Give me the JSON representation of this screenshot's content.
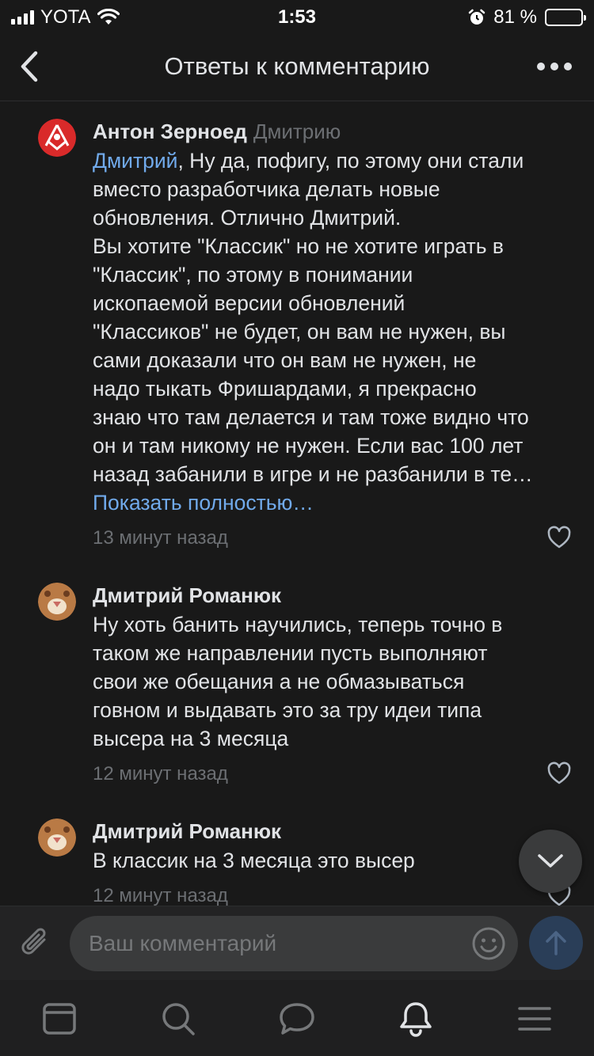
{
  "status_bar": {
    "carrier": "YOTA",
    "time": "1:53",
    "battery": "81 %",
    "battery_level": 0.81
  },
  "header": {
    "title": "Ответы к комментарию"
  },
  "comments": [
    {
      "author": "Антон Зерноед",
      "reply_to": "Дмитрию",
      "mention": "Дмитрий",
      "lines": [
        ", Ну да, пофигу, по этому они стали",
        "вместо разработчика делать новые",
        "обновления. Отлично Дмитрий.",
        "Вы хотите \"Классик\" но не хотите играть в",
        "\"Классик\", по этому в понимании",
        "ископаемой версии обновлений",
        "\"Классиков\" не будет, он вам не нужен, вы",
        "сами доказали что он вам не нужен, не",
        "надо тыкать Фришардами, я прекрасно",
        "знаю что там делается и там тоже видно что",
        "он и там никому не нужен. Если вас 100 лет",
        "назад забанили в игре и не разбанили в те…"
      ],
      "show_more": "Показать полностью…",
      "time": "13 минут назад"
    },
    {
      "author": "Дмитрий Романюк",
      "lines": [
        "Ну хоть банить научились, теперь точно в",
        "таком же направлении пусть выполняют",
        "свои же обещания а не обмазываться",
        "говном и выдавать это за тру идеи типа",
        "высера на 3 месяца"
      ],
      "time": "12 минут назад"
    },
    {
      "author": "Дмитрий Романюк",
      "lines": [
        "В классик на 3 месяца это высер"
      ],
      "time": "12 минут назад"
    }
  ],
  "composer": {
    "placeholder": "Ваш комментарий"
  },
  "colors": {
    "background": "#191919",
    "accent": "#71aaeb",
    "secondary_text": "#6c6f73"
  },
  "tabs": [
    "news-icon",
    "search-icon",
    "messages-icon",
    "notifications-icon",
    "menu-icon"
  ],
  "active_tab": "notifications-icon"
}
